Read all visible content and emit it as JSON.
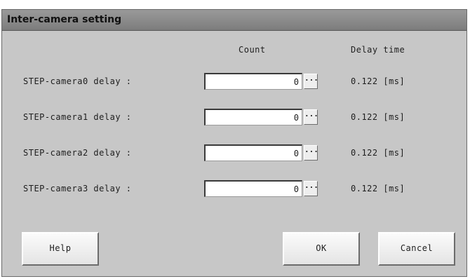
{
  "window": {
    "title": "Inter-camera setting"
  },
  "columns": {
    "count": "Count",
    "delay_time": "Delay time"
  },
  "rows": [
    {
      "label": "STEP-camera0 delay :",
      "count": "0",
      "delay": "0.122 [ms]"
    },
    {
      "label": "STEP-camera1 delay :",
      "count": "0",
      "delay": "0.122 [ms]"
    },
    {
      "label": "STEP-camera2 delay :",
      "count": "0",
      "delay": "0.122 [ms]"
    },
    {
      "label": "STEP-camera3 delay :",
      "count": "0",
      "delay": "0.122 [ms]"
    }
  ],
  "dots_label": "···",
  "buttons": {
    "help": "Help",
    "ok": "OK",
    "cancel": "Cancel"
  }
}
